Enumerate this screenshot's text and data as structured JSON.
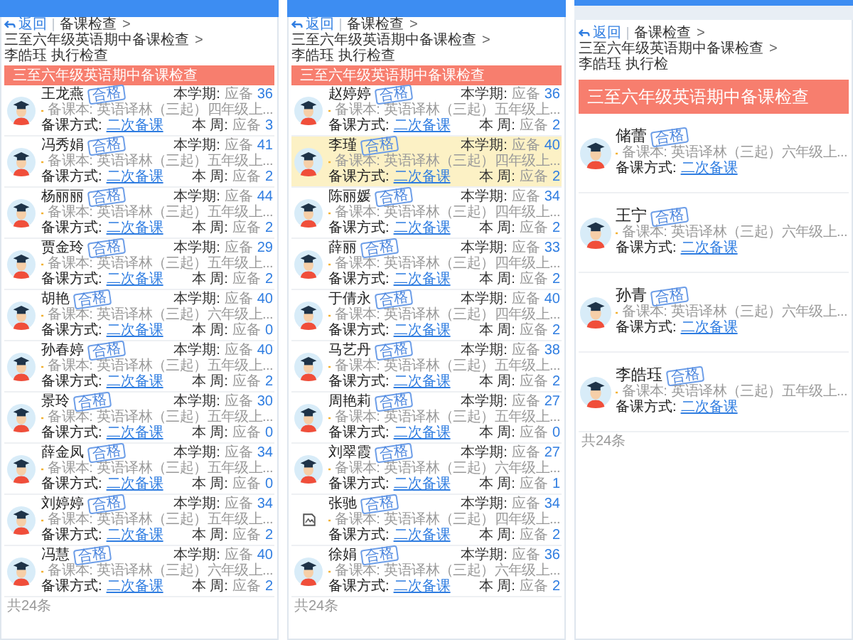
{
  "panels": [
    {
      "kind": "compact",
      "back": "返回",
      "breadcrumb": [
        "备课检查",
        "三至六年级英语期中备课检查",
        "李皓珏 执行检查"
      ],
      "separator": ">",
      "title": "三至六年级英语期中备课检查",
      "footer": "共24条",
      "rows": [
        {
          "name": "王龙燕",
          "kind": "student",
          "selected": false,
          "stamp": "合格",
          "course_label": "备课本:",
          "course": "英语译林（三起）四年级上...",
          "method_label": "备课方式:",
          "method": "二次备课",
          "term_label": "本学期:",
          "term_prefix": "应备",
          "term_value": "36",
          "week_label": "本 周:",
          "week_prefix": "应备",
          "week_value": "3"
        },
        {
          "name": "冯秀娟",
          "kind": "student",
          "selected": false,
          "stamp": "合格",
          "course_label": "备课本:",
          "course": "英语译林（三起）五年级上...",
          "method_label": "备课方式:",
          "method": "二次备课",
          "term_label": "本学期:",
          "term_prefix": "应备",
          "term_value": "41",
          "week_label": "本 周:",
          "week_prefix": "应备",
          "week_value": "2"
        },
        {
          "name": "杨丽丽",
          "kind": "student",
          "selected": false,
          "stamp": "合格",
          "course_label": "备课本:",
          "course": "英语译林（三起）五年级上...",
          "method_label": "备课方式:",
          "method": "二次备课",
          "term_label": "本学期:",
          "term_prefix": "应备",
          "term_value": "44",
          "week_label": "本 周:",
          "week_prefix": "应备",
          "week_value": "2"
        },
        {
          "name": "贾金玲",
          "kind": "student",
          "selected": false,
          "stamp": "合格",
          "course_label": "备课本:",
          "course": "英语译林（三起）五年级上...",
          "method_label": "备课方式:",
          "method": "二次备课",
          "term_label": "本学期:",
          "term_prefix": "应备",
          "term_value": "29",
          "week_label": "本 周:",
          "week_prefix": "应备",
          "week_value": "2"
        },
        {
          "name": "胡艳",
          "kind": "student",
          "selected": false,
          "stamp": "合格",
          "course_label": "备课本:",
          "course": "英语译林（三起）六年级上...",
          "method_label": "备课方式:",
          "method": "二次备课",
          "term_label": "本学期:",
          "term_prefix": "应备",
          "term_value": "40",
          "week_label": "本 周:",
          "week_prefix": "应备",
          "week_value": "0"
        },
        {
          "name": "孙春婷",
          "kind": "student",
          "selected": false,
          "stamp": "合格",
          "course_label": "备课本:",
          "course": "英语译林（三起）五年级上...",
          "method_label": "备课方式:",
          "method": "二次备课",
          "term_label": "本学期:",
          "term_prefix": "应备",
          "term_value": "40",
          "week_label": "本 周:",
          "week_prefix": "应备",
          "week_value": "2"
        },
        {
          "name": "景玲",
          "kind": "student",
          "selected": false,
          "stamp": "合格",
          "course_label": "备课本:",
          "course": "英语译林（三起）五年级上...",
          "method_label": "备课方式:",
          "method": "二次备课",
          "term_label": "本学期:",
          "term_prefix": "应备",
          "term_value": "30",
          "week_label": "本 周:",
          "week_prefix": "应备",
          "week_value": "0"
        },
        {
          "name": "薛金凤",
          "kind": "student",
          "selected": false,
          "stamp": "合格",
          "course_label": "备课本:",
          "course": "英语译林（三起）五年级上...",
          "method_label": "备课方式:",
          "method": "二次备课",
          "term_label": "本学期:",
          "term_prefix": "应备",
          "term_value": "34",
          "week_label": "本 周:",
          "week_prefix": "应备",
          "week_value": "0"
        },
        {
          "name": "刘婷婷",
          "kind": "student",
          "selected": false,
          "stamp": "合格",
          "course_label": "备课本:",
          "course": "英语译林（三起）五年级上...",
          "method_label": "备课方式:",
          "method": "二次备课",
          "term_label": "本学期:",
          "term_prefix": "应备",
          "term_value": "34",
          "week_label": "本 周:",
          "week_prefix": "应备",
          "week_value": "2"
        },
        {
          "name": "冯慧",
          "kind": "student",
          "selected": false,
          "stamp": "合格",
          "course_label": "备课本:",
          "course": "英语译林（三起）六年级上...",
          "method_label": "备课方式:",
          "method": "二次备课",
          "term_label": "本学期:",
          "term_prefix": "应备",
          "term_value": "40",
          "week_label": "本 周:",
          "week_prefix": "应备",
          "week_value": "2"
        }
      ]
    },
    {
      "kind": "compact",
      "back": "返回",
      "breadcrumb": [
        "备课检查",
        "三至六年级英语期中备课检查",
        "李皓珏 执行检查"
      ],
      "separator": ">",
      "title": "三至六年级英语期中备课检查",
      "footer": "共24条",
      "rows": [
        {
          "name": "赵婷婷",
          "kind": "student",
          "selected": false,
          "stamp": "合格",
          "course_label": "备课本:",
          "course": "英语译林（三起）五年级上...",
          "method_label": "备课方式:",
          "method": "二次备课",
          "term_label": "本学期:",
          "term_prefix": "应备",
          "term_value": "36",
          "week_label": "本 周:",
          "week_prefix": "应备",
          "week_value": "2"
        },
        {
          "name": "李瑾",
          "kind": "student",
          "selected": true,
          "stamp": "合格",
          "course_label": "备课本:",
          "course": "英语译林（三起）四年级上...",
          "method_label": "备课方式:",
          "method": "二次备课",
          "term_label": "本学期:",
          "term_prefix": "应备",
          "term_value": "40",
          "week_label": "本 周:",
          "week_prefix": "应备",
          "week_value": "2"
        },
        {
          "name": "陈丽媛",
          "kind": "student",
          "selected": false,
          "stamp": "合格",
          "course_label": "备课本:",
          "course": "英语译林（三起）四年级上...",
          "method_label": "备课方式:",
          "method": "二次备课",
          "term_label": "本学期:",
          "term_prefix": "应备",
          "term_value": "34",
          "week_label": "本 周:",
          "week_prefix": "应备",
          "week_value": "2"
        },
        {
          "name": "薛丽",
          "kind": "student",
          "selected": false,
          "stamp": "合格",
          "course_label": "备课本:",
          "course": "英语译林（三起）四年级上...",
          "method_label": "备课方式:",
          "method": "二次备课",
          "term_label": "本学期:",
          "term_prefix": "应备",
          "term_value": "33",
          "week_label": "本 周:",
          "week_prefix": "应备",
          "week_value": "2"
        },
        {
          "name": "于倩永",
          "kind": "student",
          "selected": false,
          "stamp": "合格",
          "course_label": "备课本:",
          "course": "英语译林（三起）四年级上...",
          "method_label": "备课方式:",
          "method": "二次备课",
          "term_label": "本学期:",
          "term_prefix": "应备",
          "term_value": "40",
          "week_label": "本 周:",
          "week_prefix": "应备",
          "week_value": "2"
        },
        {
          "name": "马艺丹",
          "kind": "student",
          "selected": false,
          "stamp": "合格",
          "course_label": "备课本:",
          "course": "英语译林（三起）五年级上...",
          "method_label": "备课方式:",
          "method": "二次备课",
          "term_label": "本学期:",
          "term_prefix": "应备",
          "term_value": "38",
          "week_label": "本 周:",
          "week_prefix": "应备",
          "week_value": "2"
        },
        {
          "name": "周艳莉",
          "kind": "student",
          "selected": false,
          "stamp": "合格",
          "course_label": "备课本:",
          "course": "英语译林（三起）五年级上...",
          "method_label": "备课方式:",
          "method": "二次备课",
          "term_label": "本学期:",
          "term_prefix": "应备",
          "term_value": "27",
          "week_label": "本 周:",
          "week_prefix": "应备",
          "week_value": "0"
        },
        {
          "name": "刘翠霞",
          "kind": "student",
          "selected": false,
          "stamp": "合格",
          "course_label": "备课本:",
          "course": "英语译林（三起）六年级上...",
          "method_label": "备课方式:",
          "method": "二次备课",
          "term_label": "本学期:",
          "term_prefix": "应备",
          "term_value": "27",
          "week_label": "本 周:",
          "week_prefix": "应备",
          "week_value": "1"
        },
        {
          "name": "张驰",
          "kind": "broken",
          "selected": false,
          "stamp": "合格",
          "course_label": "备课本:",
          "course": "英语译林（三起）四年级上...",
          "method_label": "备课方式:",
          "method": "二次备课",
          "term_label": "本学期:",
          "term_prefix": "应备",
          "term_value": "34",
          "week_label": "本 周:",
          "week_prefix": "应备",
          "week_value": "2"
        },
        {
          "name": "徐娟",
          "kind": "student",
          "selected": false,
          "stamp": "合格",
          "course_label": "备课本:",
          "course": "英语译林（三起）六年级上...",
          "method_label": "备课方式:",
          "method": "二次备课",
          "term_label": "本学期:",
          "term_prefix": "应备",
          "term_value": "36",
          "week_label": "本 周:",
          "week_prefix": "应备",
          "week_value": "2"
        }
      ]
    },
    {
      "kind": "wide",
      "back": "返回",
      "breadcrumb": [
        "备课检查",
        "三至六年级英语期中备课检查",
        "李皓珏 执行检"
      ],
      "separator": ">",
      "title": "三至六年级英语期中备课检查",
      "footer": "共24条",
      "rows": [
        {
          "name": "储蕾",
          "kind": "student",
          "selected": false,
          "stamp": "合格",
          "course_label": "备课本:",
          "course": "英语译林（三起）六年级上...",
          "method_label": "备课方式:",
          "method": "二次备课"
        },
        {
          "name": "王宁",
          "kind": "student",
          "selected": false,
          "stamp": "合格",
          "course_label": "备课本:",
          "course": "英语译林（三起）六年级上...",
          "method_label": "备课方式:",
          "method": "二次备课"
        },
        {
          "name": "孙青",
          "kind": "student",
          "selected": false,
          "stamp": "合格",
          "course_label": "备课本:",
          "course": "英语译林（三起）六年级上...",
          "method_label": "备课方式:",
          "method": "二次备课"
        },
        {
          "name": "李皓珏",
          "kind": "student",
          "selected": false,
          "stamp": "合格",
          "course_label": "备课本:",
          "course": "英语译林（三起）五年级上...",
          "method_label": "备课方式:",
          "method": "二次备课"
        }
      ]
    }
  ]
}
